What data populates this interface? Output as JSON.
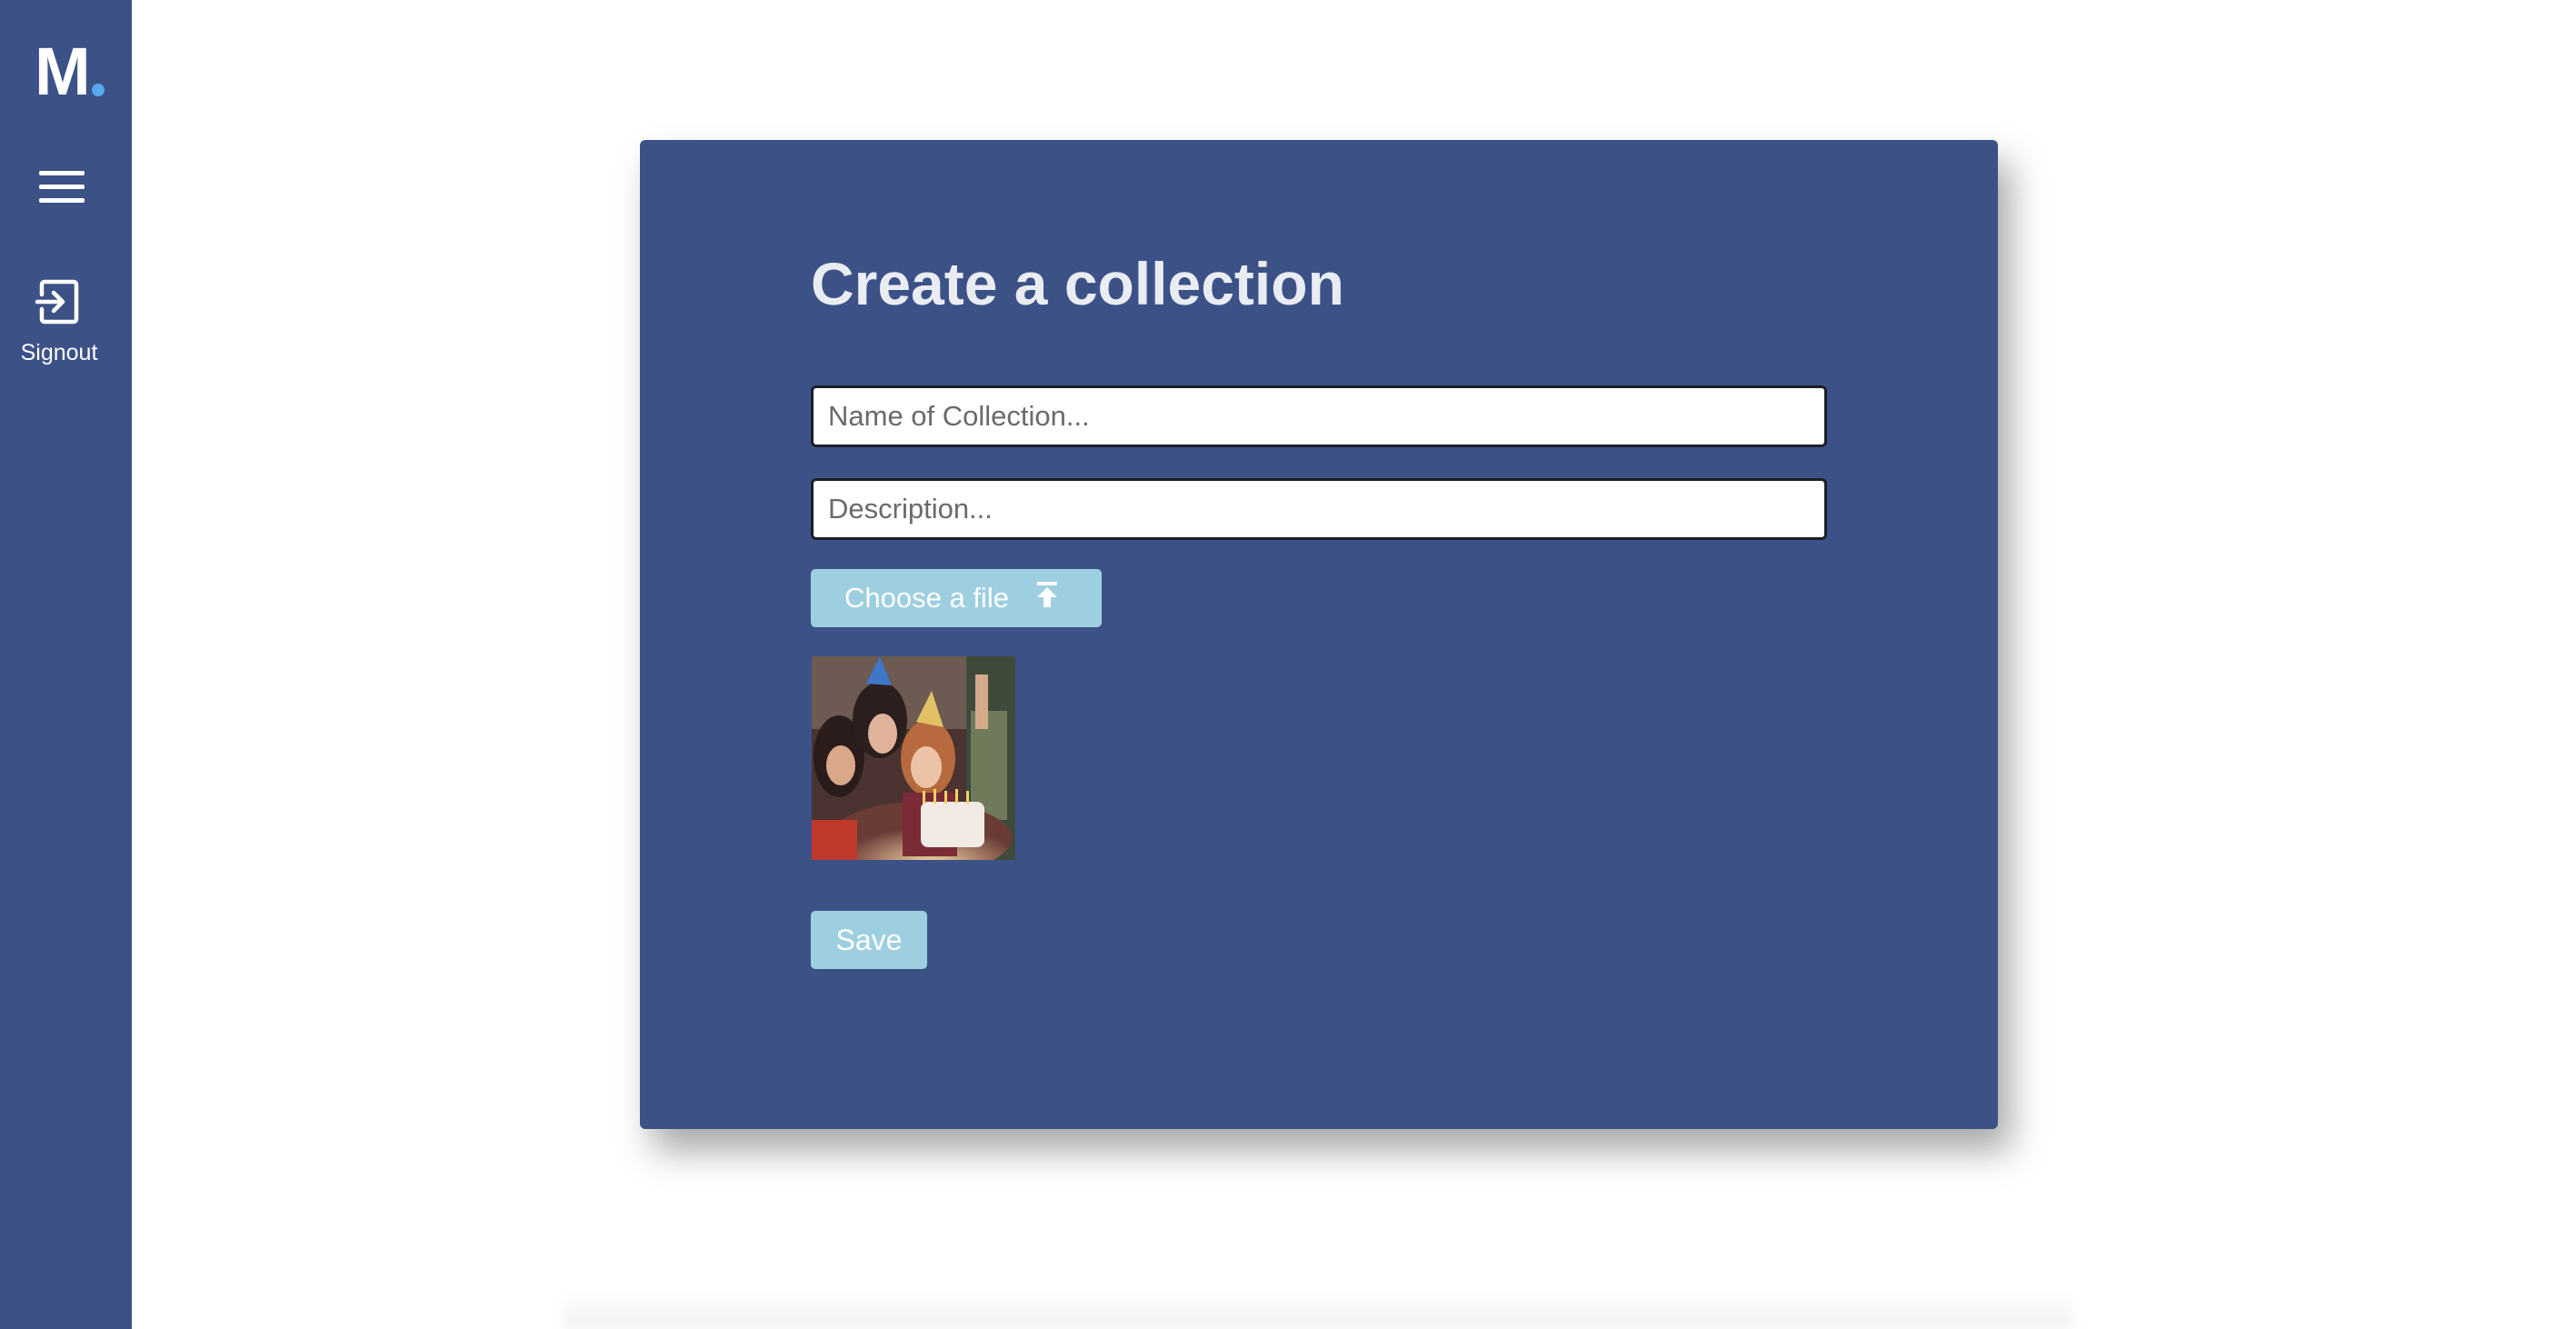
{
  "app": {
    "logo_letter": "M"
  },
  "sidebar": {
    "menu_icon": "hamburger-menu-icon",
    "signout": {
      "icon": "signout-icon",
      "label": "Signout"
    }
  },
  "form": {
    "title": "Create a collection",
    "name_placeholder": "Name of Collection...",
    "name_value": "",
    "description_placeholder": "Description...",
    "description_value": "",
    "file_button_label": "Choose a file",
    "file_button_icon": "upload-icon",
    "save_label": "Save"
  },
  "colors": {
    "sidebar_bg": "#3c5287",
    "card_bg": "#3c5287",
    "button_bg": "#9dcfe0",
    "logo_dot": "#5aa8ee"
  }
}
